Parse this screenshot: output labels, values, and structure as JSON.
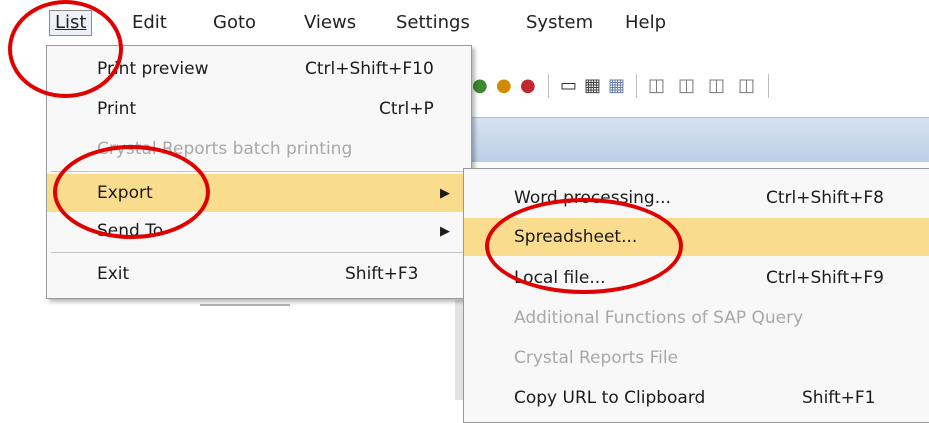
{
  "menubar": {
    "items": [
      {
        "label": "List",
        "mnemonic": "L"
      },
      {
        "label": "Edit",
        "mnemonic": "E"
      },
      {
        "label": "Goto",
        "mnemonic": "G"
      },
      {
        "label": "Views",
        "mnemonic": "i"
      },
      {
        "label": "Settings",
        "mnemonic": "S"
      },
      {
        "label": "System",
        "mnemonic": "y"
      },
      {
        "label": "Help",
        "mnemonic": "H"
      }
    ],
    "active": "List"
  },
  "list_menu": {
    "items": [
      {
        "label": "Print preview",
        "shortcut": "Ctrl+Shift+F10",
        "enabled": true
      },
      {
        "label": "Print",
        "shortcut": "Ctrl+P",
        "enabled": true
      },
      {
        "label": "Crystal Reports batch printing",
        "shortcut": "",
        "enabled": false
      },
      {
        "label": "Export",
        "shortcut": "",
        "enabled": true,
        "submenu": true,
        "highlighted": true
      },
      {
        "label": "Send To",
        "shortcut": "",
        "enabled": true,
        "submenu": true
      },
      {
        "label": "Exit",
        "shortcut": "Shift+F3",
        "enabled": true
      }
    ]
  },
  "export_submenu": {
    "items": [
      {
        "label": "Word processing...",
        "shortcut": "Ctrl+Shift+F8",
        "enabled": true
      },
      {
        "label": "Spreadsheet...",
        "shortcut": "",
        "enabled": true,
        "highlighted": true
      },
      {
        "label": "Local file...",
        "shortcut": "Ctrl+Shift+F9",
        "enabled": true
      },
      {
        "label": "Additional Functions of SAP Query",
        "shortcut": "",
        "enabled": false
      },
      {
        "label": "Crystal Reports File",
        "shortcut": "",
        "enabled": false
      },
      {
        "label": "Copy URL to Clipboard",
        "shortcut": "Shift+F1",
        "enabled": true
      }
    ]
  },
  "colors": {
    "highlight": "#fadc8e",
    "annotation": "#e10000",
    "disabled_text": "#a8a8a8"
  },
  "icons": [
    "back-icon",
    "exit-icon",
    "cancel-icon",
    "print-icon",
    "find-icon",
    "find-next-icon",
    "first-page-icon",
    "previous-page-icon",
    "next-page-icon",
    "last-page-icon"
  ]
}
